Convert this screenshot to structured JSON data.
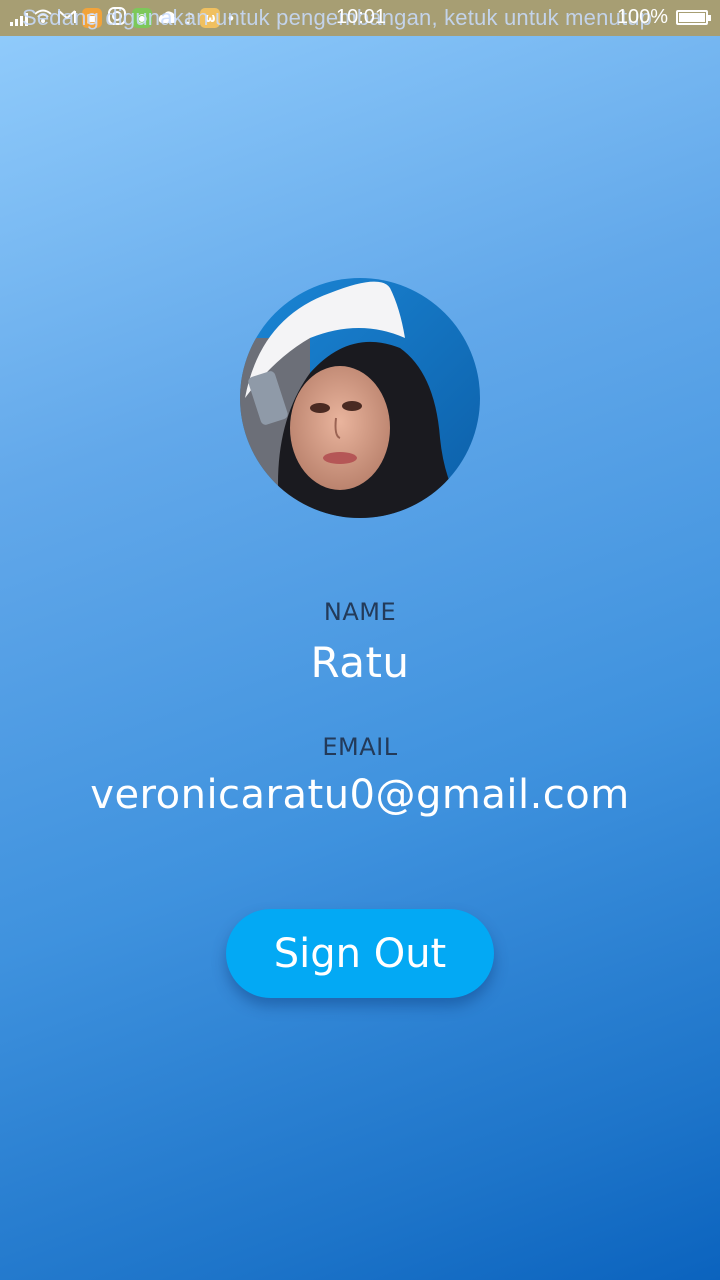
{
  "status_bar": {
    "notification_text": "Sedang digunakan untuk pengembangan, ketuk untuk menutup",
    "time": "10:01",
    "battery_percent": "100%",
    "battery_level": 1.0,
    "icons": [
      "signal-icon",
      "wifi-icon",
      "gmail-icon",
      "app-icon",
      "instagram-icon",
      "tiktok-icon",
      "cloud-icon",
      "cat-icon",
      "more-dots-icon"
    ]
  },
  "profile": {
    "name_label": "NAME",
    "name_value": "Ratu",
    "email_label": "EMAIL",
    "email_value": "veronicaratu0@gmail.com"
  },
  "actions": {
    "sign_out_label": "Sign Out"
  },
  "colors": {
    "button": "#03a9f4",
    "label_text": "#233a59",
    "value_text": "#ffffff",
    "status_bar": "#a79e73"
  }
}
